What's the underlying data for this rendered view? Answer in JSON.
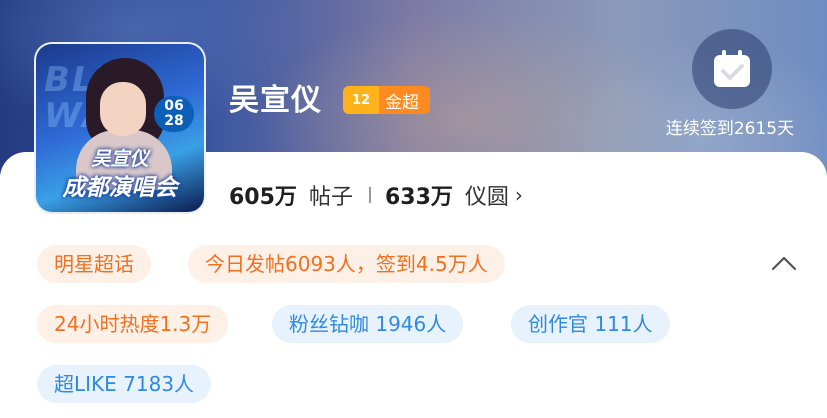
{
  "header": {
    "avatar": {
      "label": "BLUE WAVE",
      "date": "06 28",
      "line1": "吴宣仪",
      "line2": "成都演唱会"
    },
    "title": "吴宣仪",
    "badge": {
      "level": "12",
      "label": "金超"
    },
    "signin": {
      "icon": "calendar-check-icon",
      "text": "连续签到2615天"
    }
  },
  "stats": {
    "posts_value": "605万",
    "posts_label": "帖子",
    "coins_value": "633万",
    "coins_label": "仪圆",
    "chevron": "›"
  },
  "tags": [
    {
      "label": "明星超话",
      "color": "orange"
    },
    {
      "label": "今日发帖6093人，签到4.5万人",
      "color": "orange"
    },
    {
      "label": "24小时热度1.3万",
      "color": "orange"
    },
    {
      "label": "粉丝钻咖 1946人",
      "color": "blue"
    },
    {
      "label": "创作官 111人",
      "color": "blue"
    },
    {
      "label": "超LIKE 7183人",
      "color": "blue"
    }
  ],
  "colors": {
    "orange_text": "#f0701f",
    "orange_bg": "#fdf0e6",
    "blue_text": "#2f8ae0",
    "blue_bg": "#e7f2fc",
    "badge": "#ff8a1f"
  }
}
